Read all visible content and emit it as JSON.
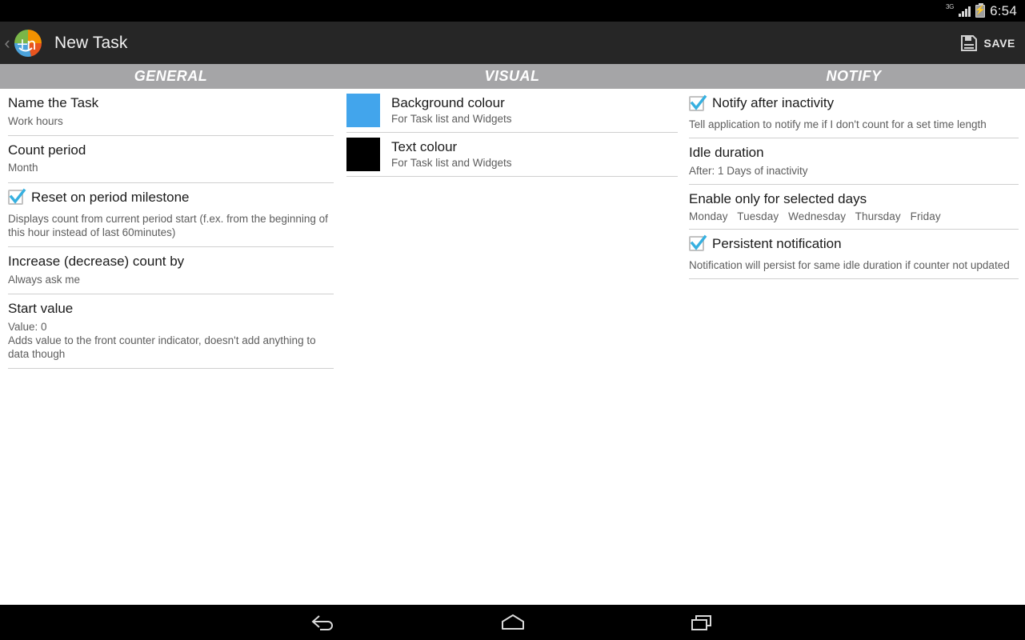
{
  "status_bar": {
    "network_label": "3G",
    "signal_icon": "signal-bars-icon",
    "battery_icon": "battery-charging-icon",
    "time": "6:54"
  },
  "action_bar": {
    "back_icon": "chevron-left-icon",
    "app_icon": "app-logo-pie-plus-n-icon",
    "title": "New Task",
    "save_icon": "floppy-disk-save-icon",
    "save_label": "SAVE"
  },
  "tabs": [
    {
      "label": "GENERAL"
    },
    {
      "label": "VISUAL"
    },
    {
      "label": "NOTIFY"
    }
  ],
  "general": {
    "rows": [
      {
        "title": "Name the Task",
        "sub": "Work hours"
      },
      {
        "title": "Count period",
        "sub": "Month"
      },
      {
        "title": "Reset on period milestone",
        "checked": true,
        "sub": "Displays count from current period start (f.ex. from the beginning of this hour instead of last 60minutes)"
      },
      {
        "title": "Increase (decrease) count by",
        "sub": "Always ask me"
      },
      {
        "title": "Start value",
        "sub": "Value: 0",
        "sub2": "Adds value to the front counter indicator, doesn't add anything to data though"
      }
    ]
  },
  "visual": {
    "rows": [
      {
        "title": "Background colour",
        "sub": "For Task list and Widgets",
        "colour": "#42a5ec"
      },
      {
        "title": "Text colour",
        "sub": "For Task list and Widgets",
        "colour": "#000000"
      }
    ]
  },
  "notify": {
    "rows": [
      {
        "title": "Notify after inactivity",
        "checked": true,
        "sub": "Tell application to notify me if I don't count for a set time length"
      },
      {
        "title": "Idle duration",
        "sub": "After: 1 Days of inactivity"
      },
      {
        "title": "Enable only for selected days",
        "days": [
          "Monday",
          "Tuesday",
          "Wednesday",
          "Thursday",
          "Friday"
        ]
      },
      {
        "title": "Persistent notification",
        "checked": true,
        "sub": "Notification will persist for same idle duration if counter not updated"
      }
    ]
  },
  "nav_bar": {
    "back_icon": "back-arrow-icon",
    "home_icon": "home-icon",
    "recents_icon": "recent-apps-icon"
  },
  "colors": {
    "accent_blue": "#42a5ec",
    "checkbox_blue": "#36b0e0",
    "tab_band": "#a5a5a7",
    "action_bar": "#262626"
  }
}
